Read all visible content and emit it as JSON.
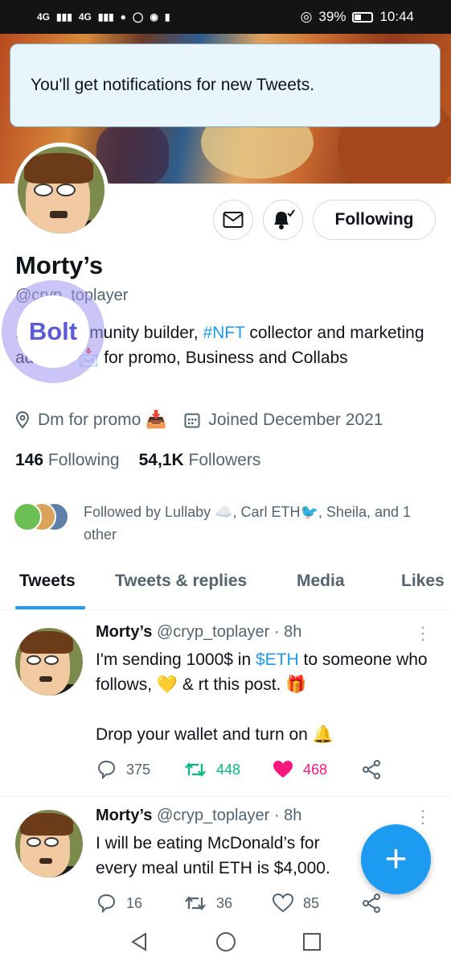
{
  "status_bar": {
    "network1": "4G",
    "network2": "4G",
    "battery": "39%",
    "time": "10:44"
  },
  "toast": {
    "text": "You'll get notifications for new Tweets."
  },
  "profile": {
    "following_button": "Following",
    "name": "Morty’s",
    "handle": "@cryp_toplayer",
    "bio": {
      "part1": "... or, community builder, ",
      "tag": "#NFT",
      "part2": " collector and marketing advisor. 📩 for promo, Business and Collabs"
    },
    "location": "Dm for promo 📥",
    "joined": "Joined December 2021",
    "following_count": "146",
    "following_label": "Following",
    "followers_count": "54,1K",
    "followers_label": "Followers",
    "followed_by": "Followed by Lullaby ☁️, Carl ETH🐦, Sheila, and 1 other"
  },
  "overlay": {
    "bolt_text": "Bolt"
  },
  "tabs": [
    {
      "label": "Tweets"
    },
    {
      "label": "Tweets & replies"
    },
    {
      "label": "Media"
    },
    {
      "label": "Likes"
    }
  ],
  "tweets": [
    {
      "name": "Morty’s",
      "meta": "@cryp_toplayer · 8h",
      "text_pre": "I'm sending 1000$ in ",
      "tag": "$ETH",
      "text_post": " to someone who follows, 💛 & rt this post. 🎁",
      "text2": "Drop your wallet and turn on 🔔",
      "replies": "375",
      "retweets": "448",
      "likes": "468"
    },
    {
      "name": "Morty’s",
      "meta": "@cryp_toplayer · 8h",
      "text": "I will be eating McDonald’s for every meal until ETH is $4,000.",
      "replies": "16",
      "retweets": "36",
      "likes": "85"
    }
  ],
  "fab": {
    "label": "+"
  },
  "colors": {
    "accent": "#1d9bf0",
    "retweet": "#00ba7c",
    "like": "#f91880"
  }
}
